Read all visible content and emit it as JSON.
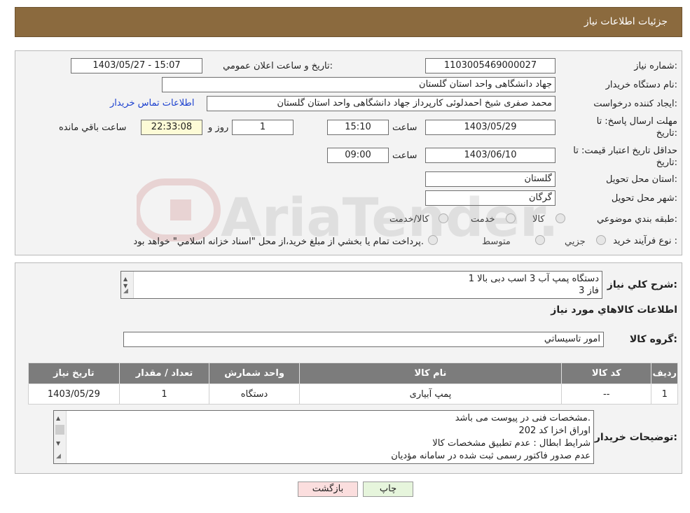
{
  "header": {
    "title": "جزئيات اطلاعات نياز"
  },
  "form": {
    "need_number_label": "شماره نياز:",
    "need_number": "1103005469000027",
    "announce_label": "تاريخ و ساعت اعلان عمومي:",
    "announce_value": "1403/05/27 - 15:07",
    "buyer_org_label": "نام دستگاه خريدار:",
    "buyer_org": "جهاد دانشگاهی واحد استان گلستان",
    "creator_label": "ايجاد كننده درخواست:",
    "creator": "محمد صفری شیخ احمدلوئی کارپرداز جهاد دانشگاهی واحد استان گلستان",
    "contact_link": "اطلاعات تماس خريدار",
    "reply_deadline_label": "مهلت ارسال پاسخ: تا تاريخ:",
    "reply_date": "1403/05/29",
    "time_label": "ساعت",
    "reply_time": "15:10",
    "days_value": "1",
    "days_label": "روز و",
    "remaining_time": "22:33:08",
    "remaining_label": "ساعت باقي مانده",
    "price_validity_label": "حداقل تاريخ اعتبار قيمت: تا تاريخ:",
    "price_date": "1403/06/10",
    "price_time": "09:00",
    "province_label": "استان محل تحويل:",
    "province": "گلستان",
    "city_label": "شهر محل تحويل:",
    "city": "گرگان",
    "category_label": "طبقه بندي موضوعي:",
    "category_options": [
      "كالا",
      "خدمت",
      "كالا/خدمت"
    ],
    "process_label": "نوع فرآيند خريد :",
    "process_options": [
      "جزيي",
      "متوسط"
    ],
    "process_note": "پرداخت تمام يا بخشي از مبلغ خريد،از محل \"اسناد خزانه اسلامي\" خواهد بود."
  },
  "watermark": {
    "text": "AriaTender.neT"
  },
  "description": {
    "label": "شرح كلي نياز:",
    "lines": [
      "1 دستگاه پمپ آب  3 اسب دبی بالا",
      "3 فاز"
    ]
  },
  "goods": {
    "section_title": "اطلاعات كالاهاي مورد نياز",
    "group_label": "گروه كالا:",
    "group_value": "امور تاسيساتي",
    "table": {
      "headers": [
        "رديف",
        "كد كالا",
        "نام كالا",
        "واحد شمارش",
        "تعداد / مقدار",
        "تاريخ نياز"
      ],
      "rows": [
        [
          "1",
          "--",
          "پمپ آبیاری",
          "دستگاه",
          "1",
          "1403/05/29"
        ]
      ]
    }
  },
  "buyer_notes": {
    "label": "توضيحات خريدار:",
    "lines": [
      "مشخصات فنی در پیوست می باشد.",
      "اوراق اخزا کد 202",
      "شرایط ابطال : عدم تطبیق مشخصات کالا",
      "عدم صدور فاکتور رسمی ثبت شده در سامانه مؤدیان"
    ]
  },
  "buttons": {
    "print": "چاپ",
    "back": "بازگشت"
  }
}
